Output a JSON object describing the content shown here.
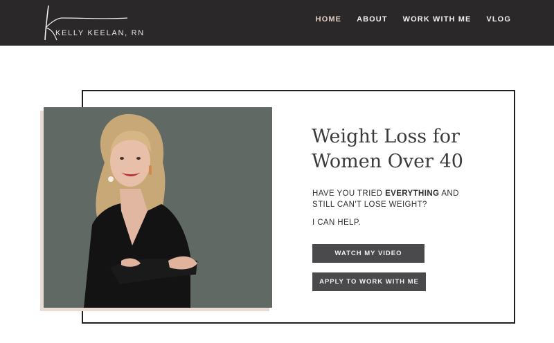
{
  "header": {
    "logo_text": "KELLY KEELAN, RN",
    "nav": [
      {
        "label": "HOME",
        "active": true
      },
      {
        "label": "ABOUT",
        "active": false
      },
      {
        "label": "WORK WITH ME",
        "active": false
      },
      {
        "label": "VLOG",
        "active": false
      }
    ]
  },
  "hero": {
    "headline_line1": "Weight Loss for",
    "headline_line2": "Women Over 40",
    "sub_pre": "HAVE YOU TRIED ",
    "sub_bold": "EVERYTHING",
    "sub_post": " AND STILL CAN'T LOSE WEIGHT?",
    "help": "I CAN HELP.",
    "button_video": "WATCH MY VIDEO",
    "button_apply": "APPLY TO WORK WITH ME"
  },
  "colors": {
    "header_bg": "#2a2829",
    "nav_active": "#e3cfc4",
    "photo_bg": "#606963",
    "photo_shadow": "#eadbd5",
    "button_bg": "#4a494c"
  }
}
